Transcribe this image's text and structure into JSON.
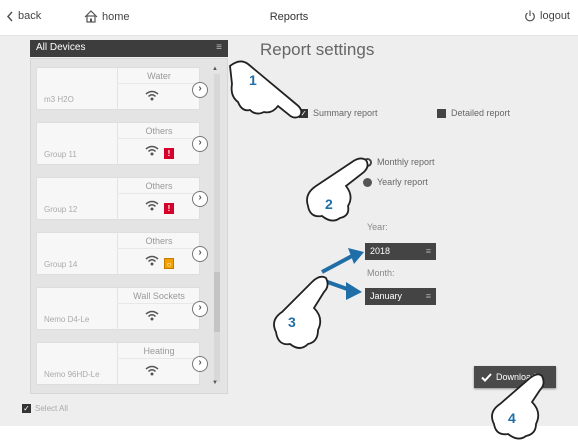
{
  "topbar": {
    "back_label": "back",
    "home_label": "home",
    "title": "Reports",
    "logout_label": "logout"
  },
  "devices": {
    "header": "All Devices",
    "items": [
      {
        "category": "Water",
        "name": "m3 H2O",
        "badge": null
      },
      {
        "category": "Others",
        "name": "Group 11",
        "badge": {
          "text": "!",
          "color": "#d6002a"
        }
      },
      {
        "category": "Others",
        "name": "Group 12",
        "badge": {
          "text": "!",
          "color": "#d6002a"
        }
      },
      {
        "category": "Others",
        "name": "Group 14",
        "badge": {
          "text": "○",
          "color": "#f2a100"
        }
      },
      {
        "category": "Wall Sockets",
        "name": "Nemo D4-Le",
        "badge": null
      },
      {
        "category": "Heating",
        "name": "Nemo 96HD-Le",
        "badge": null
      }
    ],
    "select_all_label": "Select All"
  },
  "report": {
    "title": "Report settings",
    "summary_label": "Summary report",
    "detailed_label": "Detailed report",
    "monthly_label": "Monthly report",
    "yearly_label": "Yearly report",
    "year_label": "Year:",
    "year_value": "2018",
    "month_label": "Month:",
    "month_value": "January",
    "download_label": "Download"
  },
  "callouts": [
    "1",
    "2",
    "3",
    "4"
  ],
  "colors": {
    "accent_blue": "#1f6ea8",
    "alert_red": "#d6002a",
    "alert_orange": "#f2a100",
    "dark_control": "#444444"
  }
}
